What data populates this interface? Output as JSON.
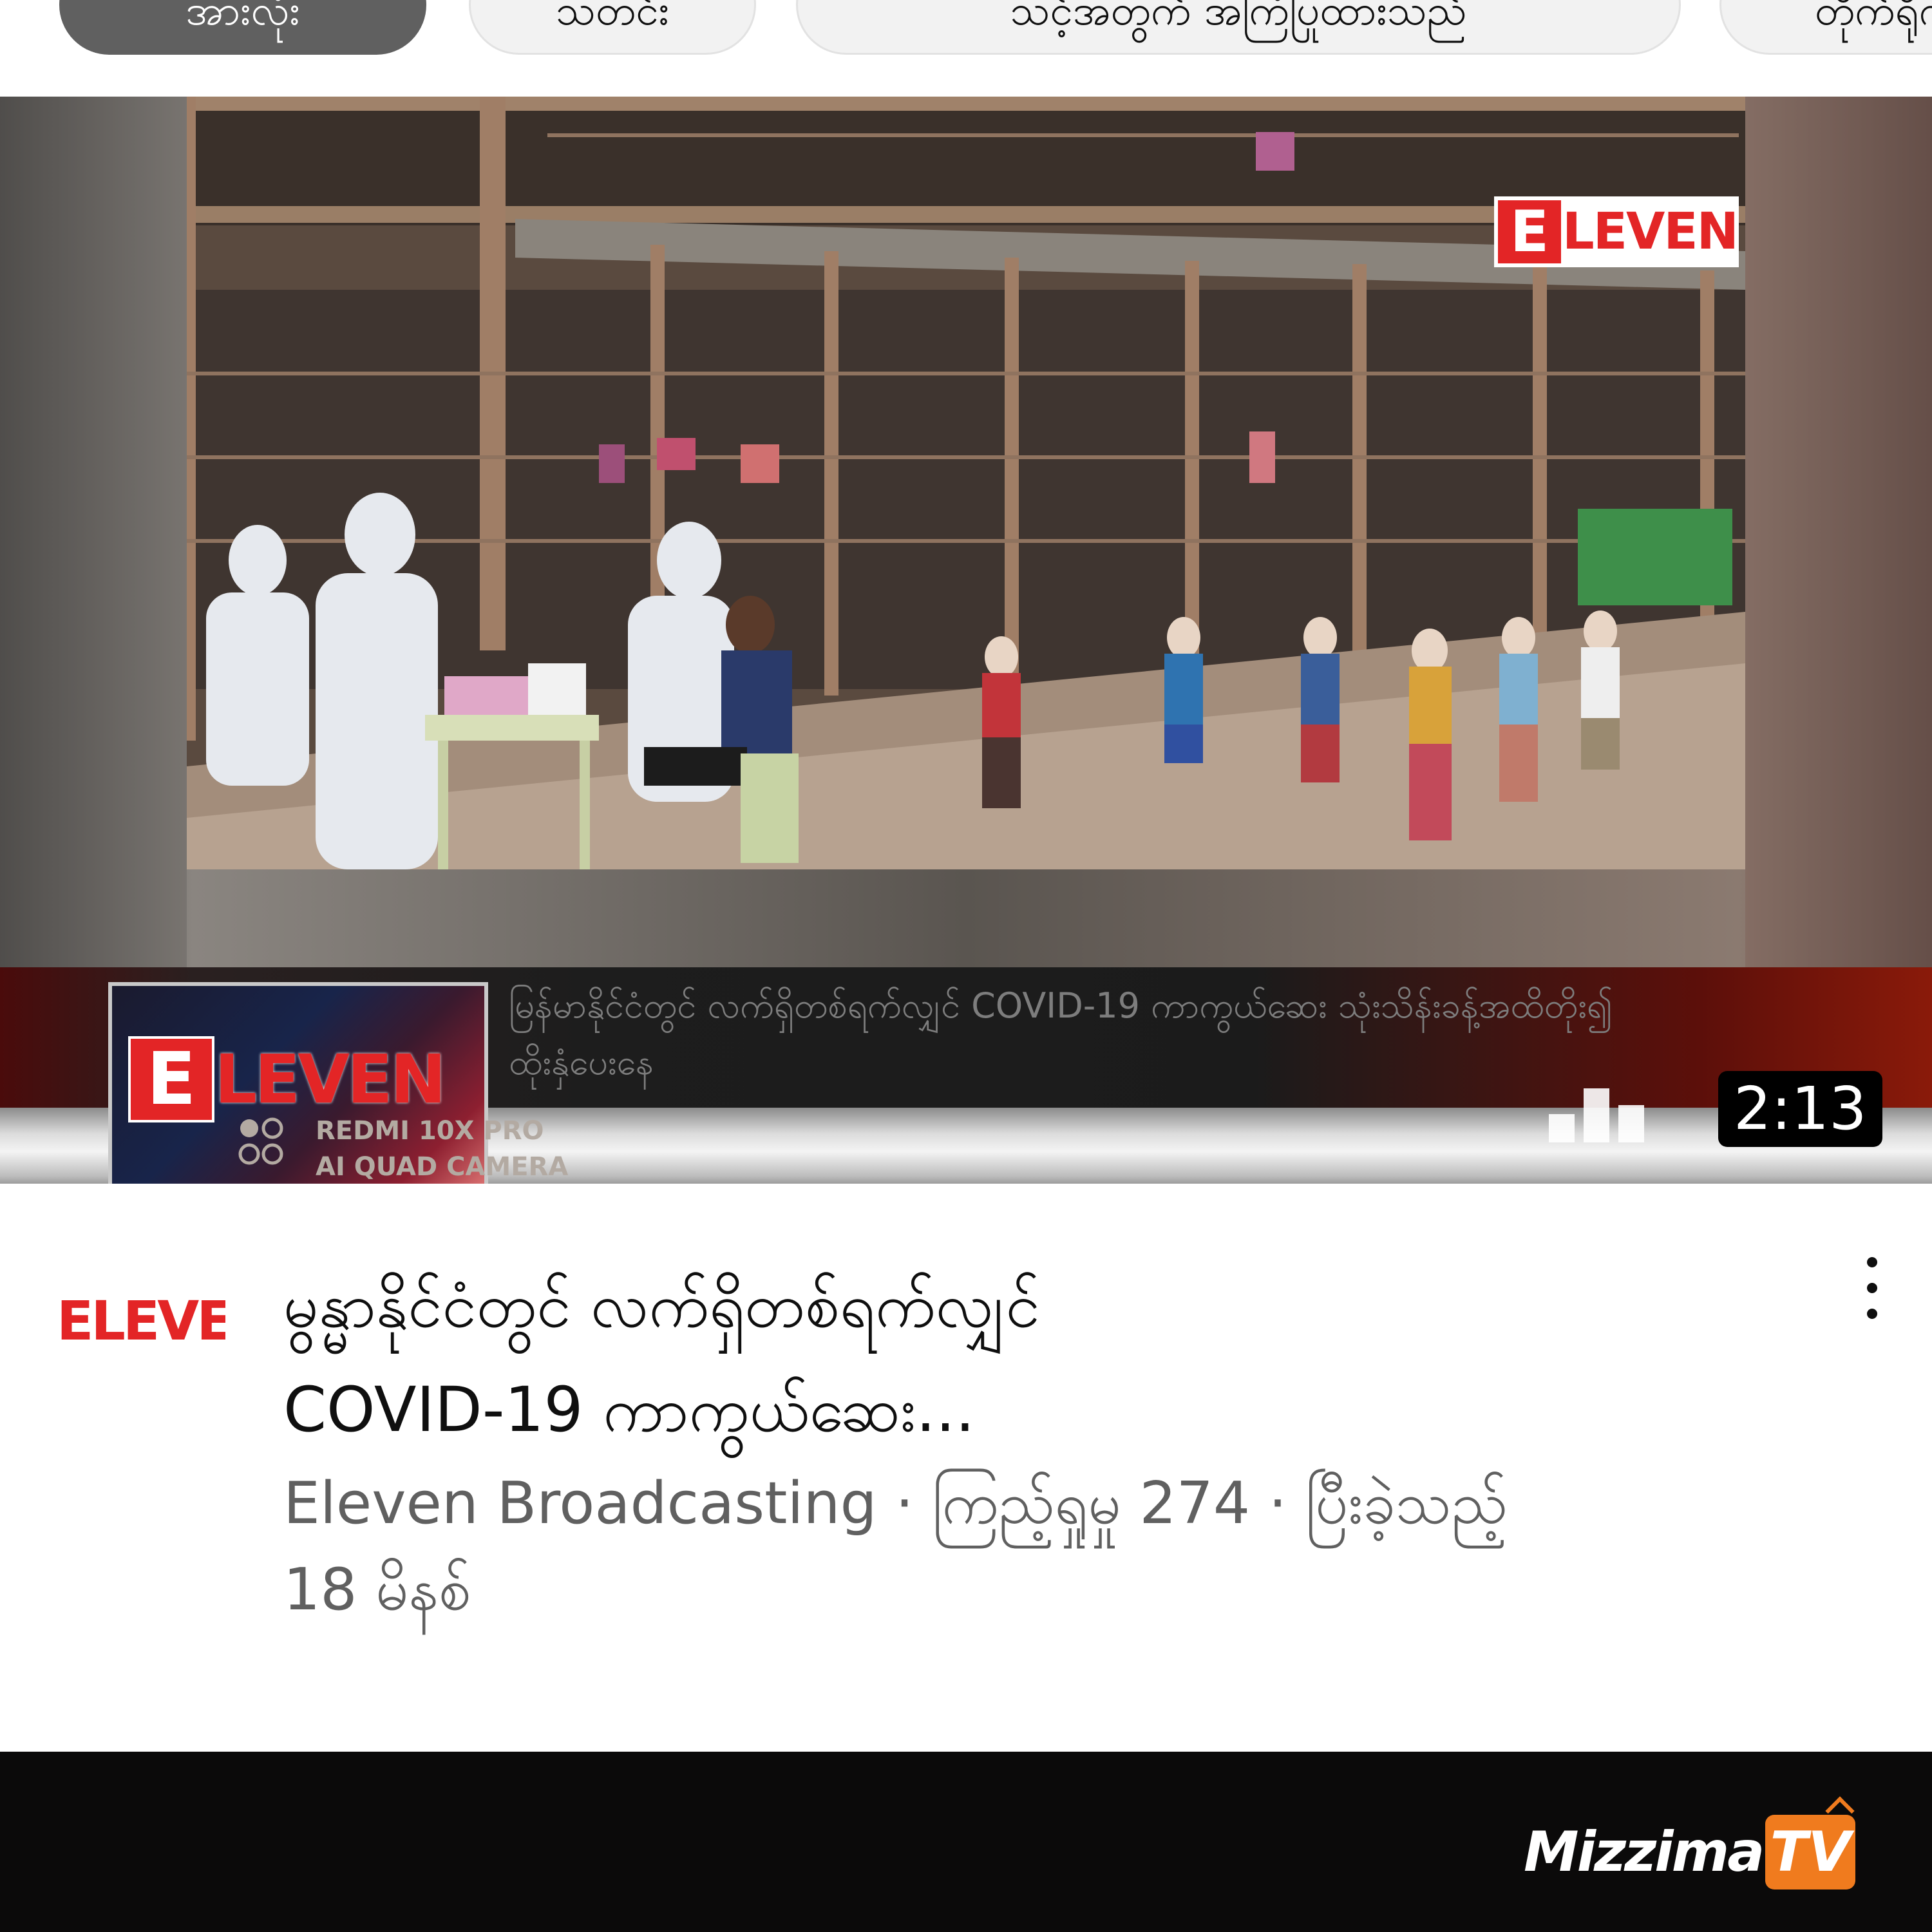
{
  "chips": [
    {
      "label": "အားလုံး",
      "selected": true
    },
    {
      "label": "သတင်း",
      "selected": false
    },
    {
      "label": "သင့်အတွက် အကြံပြုထားသည်",
      "selected": false
    },
    {
      "label": "တိုက်ရိုက်",
      "selected": false
    }
  ],
  "video": {
    "watermark_logo": {
      "initial": "E",
      "rest": "LEVEN"
    },
    "banner_logo": {
      "initial": "E",
      "rest": "LEVEN"
    },
    "ticker_lines": [
      "မြန်မာနိုင်ငံတွင် လက်ရှိတစ်ရက်လျှင် COVID-19 ကာကွယ်ဆေး သုံးသိန်းခန့်အထိတိုး၍",
      "ထိုးနှံပေးနေ"
    ],
    "camera_watermark": [
      "REDMI 10X PRO",
      "AI QUAD CAMERA"
    ],
    "duration": "2:13",
    "overlay_icon": "trending-bars-icon"
  },
  "details": {
    "title_lines": [
      "မွန္မာနိုင်ငံတွင် လက်ရှိတစ်ရက်လျှင်",
      "COVID-19 ကာကွယ်ဆေး..."
    ],
    "channel_logo_text": "ELEVEN",
    "meta_line1": "Eleven Broadcasting · ကြည့်ရှုမှု 274 · ပြီးခဲ့သည့်",
    "meta_line2": "18 မိနစ်",
    "menu_icon": "kebab-menu-icon"
  },
  "next_card": {
    "brand_text": "Mizzima",
    "brand_badge": "TV"
  },
  "colors": {
    "brand_red": "#e32526",
    "chip_selected": "#606060",
    "chip_bg": "#f2f2f2",
    "text_primary": "#0f0f0f",
    "text_secondary": "#606060",
    "mizzima_orange": "#f07b1e"
  }
}
